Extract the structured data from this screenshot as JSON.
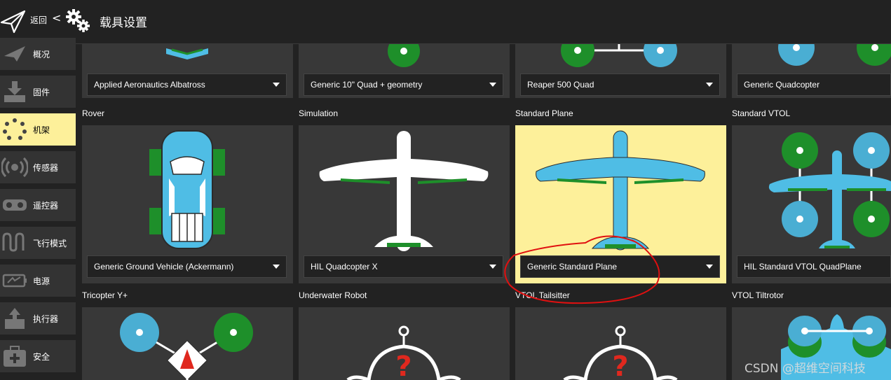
{
  "header": {
    "back_label": "返回",
    "chevron": "<",
    "title": "载具设置",
    "icons": [
      "paper-plane-icon",
      "gears-icon"
    ]
  },
  "sidebar": {
    "items": [
      {
        "label": "概况",
        "icon": "plane-icon",
        "active": false
      },
      {
        "label": "固件",
        "icon": "download-icon",
        "active": false
      },
      {
        "label": "机架",
        "icon": "airframe-dots-icon",
        "active": true
      },
      {
        "label": "传感器",
        "icon": "radio-waves-icon",
        "active": false
      },
      {
        "label": "遥控器",
        "icon": "gamepad-icon",
        "active": false
      },
      {
        "label": "飞行模式",
        "icon": "wave-icon",
        "active": false
      },
      {
        "label": "电源",
        "icon": "battery-icon",
        "active": false
      },
      {
        "label": "执行器",
        "icon": "actuator-icon",
        "active": false
      },
      {
        "label": "安全",
        "icon": "medkit-icon",
        "active": false
      }
    ]
  },
  "grid": {
    "row1": [
      {
        "selected_airframe": "Applied Aeronautics Albatross"
      },
      {
        "selected_airframe": "Generic 10\" Quad + geometry"
      },
      {
        "selected_airframe": "Reaper 500 Quad"
      },
      {
        "selected_airframe": "Generic Quadcopter"
      }
    ],
    "row2": [
      {
        "category": "Rover",
        "selected_airframe": "Generic Ground Vehicle (Ackermann)"
      },
      {
        "category": "Simulation",
        "selected_airframe": "HIL Quadcopter X"
      },
      {
        "category": "Standard Plane",
        "selected_airframe": "Generic Standard Plane",
        "selected": true
      },
      {
        "category": "Standard VTOL",
        "selected_airframe": "HIL Standard VTOL QuadPlane"
      }
    ],
    "row3": [
      {
        "category": "Tricopter Y+"
      },
      {
        "category": "Underwater Robot"
      },
      {
        "category": "VTOL Tailsitter"
      },
      {
        "category": "VTOL Tiltrotor"
      }
    ]
  },
  "watermark": "CSDN @超维空间科技",
  "colors": {
    "background": "#222222",
    "tile": "#383838",
    "selected": "#fdf09a",
    "vehicle_blue": "#4fbde5",
    "prop_green": "#1e8f2a",
    "prop_blue": "#4aaed3",
    "annotation_red": "#e01010"
  }
}
